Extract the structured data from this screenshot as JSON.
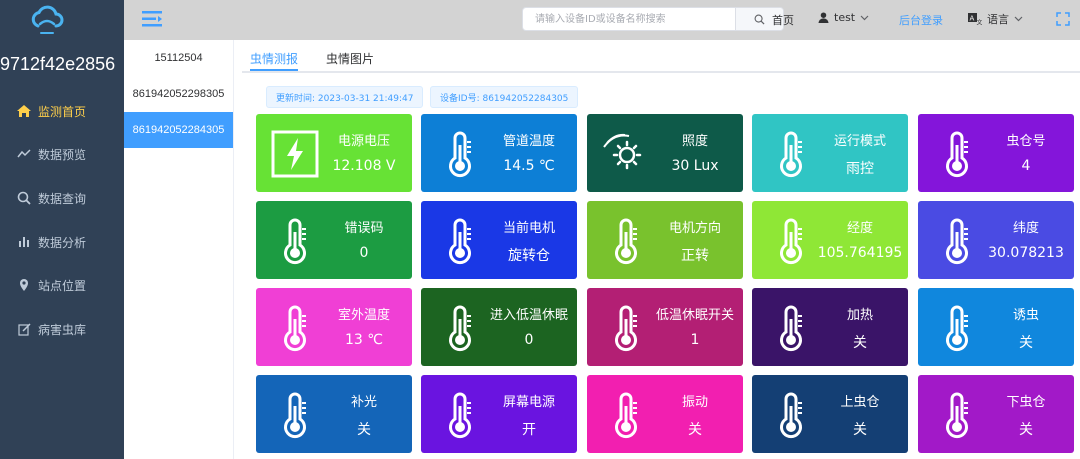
{
  "app": {
    "device_name": "9712f42e2856"
  },
  "sidebar": {
    "items": [
      {
        "label": "监测首页",
        "icon": "home-icon"
      },
      {
        "label": "数据预览",
        "icon": "trend-icon"
      },
      {
        "label": "数据查询",
        "icon": "search-icon"
      },
      {
        "label": "数据分析",
        "icon": "bar-chart-icon"
      },
      {
        "label": "站点位置",
        "icon": "location-pin-icon"
      },
      {
        "label": "病害虫库",
        "icon": "edit-icon"
      }
    ],
    "active_color": "#ffd04b"
  },
  "header": {
    "search_placeholder": "请输入设备ID或设备名称搜索",
    "home": "首页",
    "user": "test",
    "admin": "后台登录",
    "language": "语言"
  },
  "devices": [
    "15112504",
    "861942052298305",
    "861942052284305"
  ],
  "tabs": [
    "虫情测报",
    "虫情图片"
  ],
  "info": {
    "updated": "更新时间: 2023-03-31 21:49:47",
    "device_id": "设备ID号: 861942052284305"
  },
  "cards": [
    {
      "label": "电源电压",
      "value": "12.108 V",
      "color": "#67e235",
      "icon": "lightning-icon"
    },
    {
      "label": "管道温度",
      "value": "14.5 ℃",
      "color": "#0d7fd6",
      "icon": "thermometer-icon"
    },
    {
      "label": "照度",
      "value": "30 Lux",
      "color": "#0e5a49",
      "icon": "sun-icon"
    },
    {
      "label": "运行模式",
      "value": "雨控",
      "color": "#30c5c4",
      "icon": "thermometer-icon"
    },
    {
      "label": "虫仓号",
      "value": "4",
      "color": "#8415da",
      "icon": "thermometer-icon"
    },
    {
      "label": "错误码",
      "value": "0",
      "color": "#1c9c42",
      "icon": "thermometer-icon"
    },
    {
      "label": "当前电机",
      "value": "旋转仓",
      "color": "#1a38e6",
      "icon": "thermometer-icon"
    },
    {
      "label": "电机方向",
      "value": "正转",
      "color": "#79c22d",
      "icon": "thermometer-icon"
    },
    {
      "label": "经度",
      "value": "105.764195",
      "color": "#8fe736",
      "icon": "thermometer-icon"
    },
    {
      "label": "纬度",
      "value": "30.078213",
      "color": "#4a4be3",
      "icon": "thermometer-icon"
    },
    {
      "label": "室外温度",
      "value": "13 ℃",
      "color": "#f03fd5",
      "icon": "thermometer-icon"
    },
    {
      "label": "进入低温休眠",
      "value": "0",
      "color": "#1c6421",
      "icon": "thermometer-icon"
    },
    {
      "label": "低温休眠开关",
      "value": "1",
      "color": "#b31f74",
      "icon": "thermometer-icon"
    },
    {
      "label": "加热",
      "value": "关",
      "color": "#3a1468",
      "icon": "thermometer-icon"
    },
    {
      "label": "诱虫",
      "value": "关",
      "color": "#1087dd",
      "icon": "thermometer-icon"
    },
    {
      "label": "补光",
      "value": "关",
      "color": "#1465b8",
      "icon": "thermometer-icon"
    },
    {
      "label": "屏幕电源",
      "value": "开",
      "color": "#6a14e0",
      "icon": "thermometer-icon"
    },
    {
      "label": "振动",
      "value": "关",
      "color": "#f21fb0",
      "icon": "thermometer-icon"
    },
    {
      "label": "上虫仓",
      "value": "关",
      "color": "#143f74",
      "icon": "thermometer-icon"
    },
    {
      "label": "下虫仓",
      "value": "关",
      "color": "#a219c8",
      "icon": "thermometer-icon"
    }
  ]
}
